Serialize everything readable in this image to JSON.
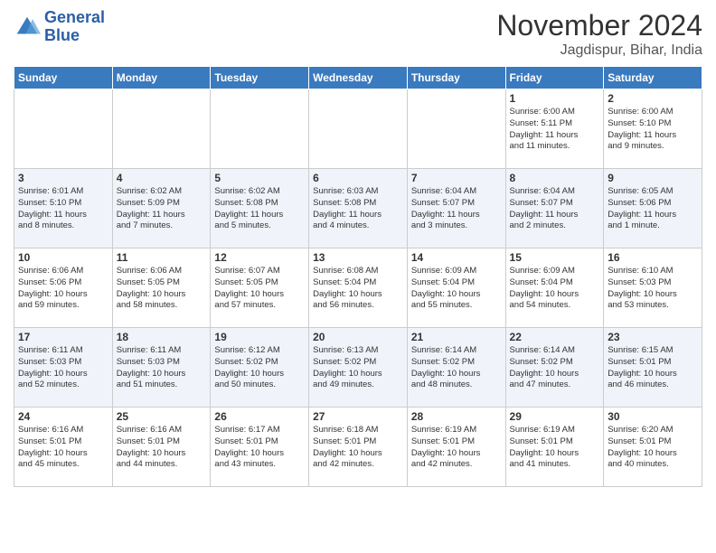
{
  "logo": {
    "line1": "General",
    "line2": "Blue"
  },
  "header": {
    "month": "November 2024",
    "location": "Jagdispur, Bihar, India"
  },
  "weekdays": [
    "Sunday",
    "Monday",
    "Tuesday",
    "Wednesday",
    "Thursday",
    "Friday",
    "Saturday"
  ],
  "weeks": [
    [
      {
        "day": "",
        "info": ""
      },
      {
        "day": "",
        "info": ""
      },
      {
        "day": "",
        "info": ""
      },
      {
        "day": "",
        "info": ""
      },
      {
        "day": "",
        "info": ""
      },
      {
        "day": "1",
        "info": "Sunrise: 6:00 AM\nSunset: 5:11 PM\nDaylight: 11 hours\nand 11 minutes."
      },
      {
        "day": "2",
        "info": "Sunrise: 6:00 AM\nSunset: 5:10 PM\nDaylight: 11 hours\nand 9 minutes."
      }
    ],
    [
      {
        "day": "3",
        "info": "Sunrise: 6:01 AM\nSunset: 5:10 PM\nDaylight: 11 hours\nand 8 minutes."
      },
      {
        "day": "4",
        "info": "Sunrise: 6:02 AM\nSunset: 5:09 PM\nDaylight: 11 hours\nand 7 minutes."
      },
      {
        "day": "5",
        "info": "Sunrise: 6:02 AM\nSunset: 5:08 PM\nDaylight: 11 hours\nand 5 minutes."
      },
      {
        "day": "6",
        "info": "Sunrise: 6:03 AM\nSunset: 5:08 PM\nDaylight: 11 hours\nand 4 minutes."
      },
      {
        "day": "7",
        "info": "Sunrise: 6:04 AM\nSunset: 5:07 PM\nDaylight: 11 hours\nand 3 minutes."
      },
      {
        "day": "8",
        "info": "Sunrise: 6:04 AM\nSunset: 5:07 PM\nDaylight: 11 hours\nand 2 minutes."
      },
      {
        "day": "9",
        "info": "Sunrise: 6:05 AM\nSunset: 5:06 PM\nDaylight: 11 hours\nand 1 minute."
      }
    ],
    [
      {
        "day": "10",
        "info": "Sunrise: 6:06 AM\nSunset: 5:06 PM\nDaylight: 10 hours\nand 59 minutes."
      },
      {
        "day": "11",
        "info": "Sunrise: 6:06 AM\nSunset: 5:05 PM\nDaylight: 10 hours\nand 58 minutes."
      },
      {
        "day": "12",
        "info": "Sunrise: 6:07 AM\nSunset: 5:05 PM\nDaylight: 10 hours\nand 57 minutes."
      },
      {
        "day": "13",
        "info": "Sunrise: 6:08 AM\nSunset: 5:04 PM\nDaylight: 10 hours\nand 56 minutes."
      },
      {
        "day": "14",
        "info": "Sunrise: 6:09 AM\nSunset: 5:04 PM\nDaylight: 10 hours\nand 55 minutes."
      },
      {
        "day": "15",
        "info": "Sunrise: 6:09 AM\nSunset: 5:04 PM\nDaylight: 10 hours\nand 54 minutes."
      },
      {
        "day": "16",
        "info": "Sunrise: 6:10 AM\nSunset: 5:03 PM\nDaylight: 10 hours\nand 53 minutes."
      }
    ],
    [
      {
        "day": "17",
        "info": "Sunrise: 6:11 AM\nSunset: 5:03 PM\nDaylight: 10 hours\nand 52 minutes."
      },
      {
        "day": "18",
        "info": "Sunrise: 6:11 AM\nSunset: 5:03 PM\nDaylight: 10 hours\nand 51 minutes."
      },
      {
        "day": "19",
        "info": "Sunrise: 6:12 AM\nSunset: 5:02 PM\nDaylight: 10 hours\nand 50 minutes."
      },
      {
        "day": "20",
        "info": "Sunrise: 6:13 AM\nSunset: 5:02 PM\nDaylight: 10 hours\nand 49 minutes."
      },
      {
        "day": "21",
        "info": "Sunrise: 6:14 AM\nSunset: 5:02 PM\nDaylight: 10 hours\nand 48 minutes."
      },
      {
        "day": "22",
        "info": "Sunrise: 6:14 AM\nSunset: 5:02 PM\nDaylight: 10 hours\nand 47 minutes."
      },
      {
        "day": "23",
        "info": "Sunrise: 6:15 AM\nSunset: 5:01 PM\nDaylight: 10 hours\nand 46 minutes."
      }
    ],
    [
      {
        "day": "24",
        "info": "Sunrise: 6:16 AM\nSunset: 5:01 PM\nDaylight: 10 hours\nand 45 minutes."
      },
      {
        "day": "25",
        "info": "Sunrise: 6:16 AM\nSunset: 5:01 PM\nDaylight: 10 hours\nand 44 minutes."
      },
      {
        "day": "26",
        "info": "Sunrise: 6:17 AM\nSunset: 5:01 PM\nDaylight: 10 hours\nand 43 minutes."
      },
      {
        "day": "27",
        "info": "Sunrise: 6:18 AM\nSunset: 5:01 PM\nDaylight: 10 hours\nand 42 minutes."
      },
      {
        "day": "28",
        "info": "Sunrise: 6:19 AM\nSunset: 5:01 PM\nDaylight: 10 hours\nand 42 minutes."
      },
      {
        "day": "29",
        "info": "Sunrise: 6:19 AM\nSunset: 5:01 PM\nDaylight: 10 hours\nand 41 minutes."
      },
      {
        "day": "30",
        "info": "Sunrise: 6:20 AM\nSunset: 5:01 PM\nDaylight: 10 hours\nand 40 minutes."
      }
    ]
  ]
}
